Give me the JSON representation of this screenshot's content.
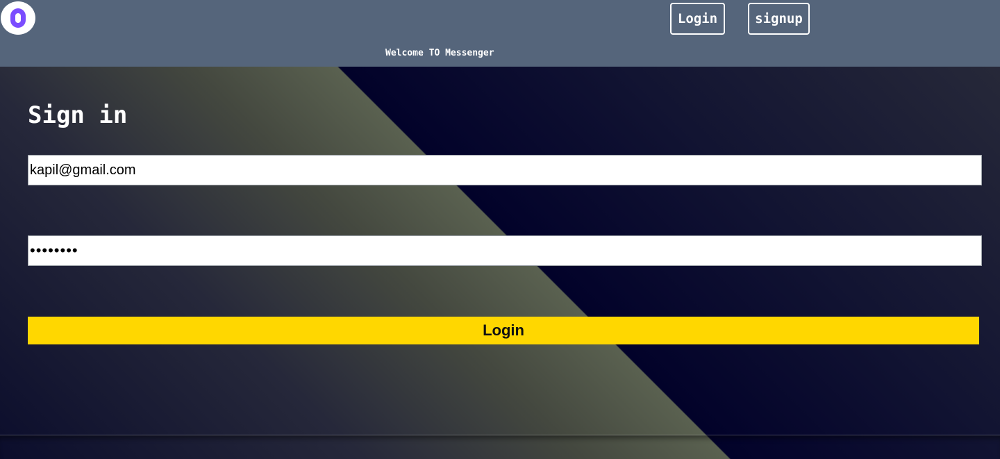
{
  "nav": {
    "logo_icon": "messenger-logo-icon",
    "login_label": "Login",
    "signup_label": "signup",
    "welcome_text": "Welcome TO Messenger"
  },
  "form": {
    "title": "Sign in",
    "email_value": "kapil@gmail.com",
    "password_value": "••••••••",
    "submit_label": "Login"
  },
  "colors": {
    "navbar": "#55657b",
    "button_accent": "#ffd700",
    "logo_accent": "#7b4dff"
  }
}
